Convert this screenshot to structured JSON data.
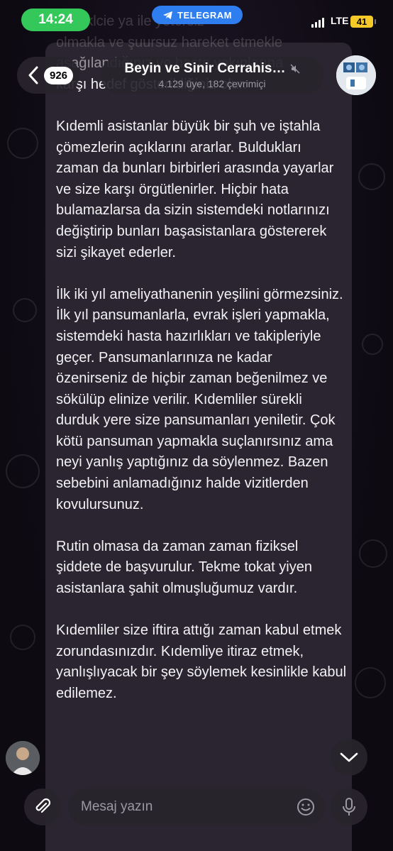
{
  "status_bar": {
    "time": "14:24",
    "app_pill": "TELEGRAM",
    "network": "LTE",
    "battery": "41"
  },
  "header": {
    "unread_count": "926",
    "chat_title": "Beyin ve Sinir Cerrahis…",
    "chat_subtitle": "4.129 üye, 182 çevrimiçi"
  },
  "message": {
    "partial_top_1": "mekiklcie ya ile yetersiz",
    "partial_top_2": "olmakla ve şuursuz hareket etmekle",
    "partial_top_3": "aşağılandığınız ve hasta yakınlarına",
    "line_karsi": "karşı hedef gösterildiğiniz olur.",
    "paragraphs": [
      "Kıdemli asistanlar büyük bir şuh ve iştahla çömezlerin açıklarını ararlar. Buldukları zaman da bunları birbirleri arasında yayarlar ve size karşı örgütlenirler. Hiçbir hata bulamazlarsa da sizin sistemdeki notlarınızı değiştirip bunları başasistanlara göstererek sizi şikayet ederler.",
      "İlk iki yıl ameliyathanenin yeşilini görmezsiniz. İlk yıl pansumanlarla, evrak işleri yapmakla, sistemdeki hasta hazırlıkları ve takipleriyle geçer. Pansumanlarınıza ne kadar özenirseniz de hiçbir zaman beğenilmez ve sökülüp elinize verilir. Kıdemliler sürekli durduk yere size pansumanları yeniletir. Çok kötü pansuman yapmakla suçlanırsınız ama neyi yanlış yaptığınız da söylenmez. Bazen sebebini anlamadığınız halde vizitlerden kovulursunuz.",
      "Rutin olmasa da zaman zaman fiziksel şiddete de başvurulur. Tekme tokat yiyen asistanlara şahit olmuşluğumuz vardır.",
      "Kıdemliler size iftira attığı zaman kabul etmek zorundasınızdır. Kıdemliye itiraz etmek, yanlışlıyacak bir şey söylemek kesinlikle kabul edilemez."
    ]
  },
  "input": {
    "placeholder": "Mesaj yazın"
  },
  "icons": {
    "back": "chevron-left-icon",
    "mute": "muted-speaker-icon",
    "scroll": "chevron-down-icon",
    "attach": "paperclip-icon",
    "emoji": "smiley-icon",
    "mic": "microphone-icon"
  },
  "colors": {
    "time_pill": "#34c759",
    "telegram_pill": "#2f7ef0",
    "battery": "#f5c928",
    "bubble": "#2a2530"
  }
}
